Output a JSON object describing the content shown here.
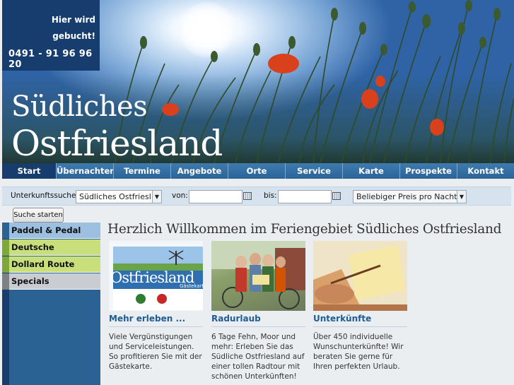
{
  "header": {
    "hotline_line1": "Hier wird",
    "hotline_line2": "gebucht!",
    "phone": "0491 - 91 96 96 20",
    "title_line1": "Südliches",
    "title_line2": "Ostfriesland"
  },
  "nav": {
    "items": [
      "Start",
      "Übernachten",
      "Termine",
      "Angebote",
      "Orte",
      "Service",
      "Karte",
      "Prospekte",
      "Kontakt"
    ],
    "active": "Start"
  },
  "search": {
    "label": "Unterkunftssuche",
    "region_value": "Südliches Ostfriesl",
    "from_label": "von:",
    "to_label": "bis:",
    "price_value": "Beliebiger Preis pro Nacht",
    "submit_label": "Suche starten"
  },
  "sidebar": {
    "items": [
      {
        "label": "Paddel & Pedal",
        "color": "#9dc0e0",
        "accent": "#2a6293"
      },
      {
        "label": "Deutsche Fehnroute",
        "color": "#c8df7c",
        "accent": "#7fa63a"
      },
      {
        "label": "Dollard Route",
        "color": "#c8df7c",
        "accent": "#7fa63a"
      },
      {
        "label": "Specials",
        "color": "#c9ccd0",
        "accent": "#7d8185"
      }
    ]
  },
  "main": {
    "welcome": "Herzlich Willkommen im Feriengebiet Südliches Ostfriesland",
    "cards": [
      {
        "title": "Mehr erleben ...",
        "text": "Viele Vergünstigungen und Serviceleistungen. So profitieren Sie mit der Gästekarte.",
        "image_text": "Ostfriesland",
        "image_subtext": "Gästekarte"
      },
      {
        "title": "Radurlaub",
        "text": "6 Tage Fehn, Moor und mehr: Erleben Sie das Südliche Ostfriesland auf einer tollen Radtour mit schönen Unterkünften!"
      },
      {
        "title": "Unterkünfte",
        "text": "Über 450 individuelle Wunschunterkünfte! Wir beraten Sie gerne für Ihren perfekten Urlaub."
      }
    ]
  },
  "colors": {
    "brand_dark": "#173d6f",
    "brand": "#2a6293",
    "link": "#1f5c93"
  }
}
